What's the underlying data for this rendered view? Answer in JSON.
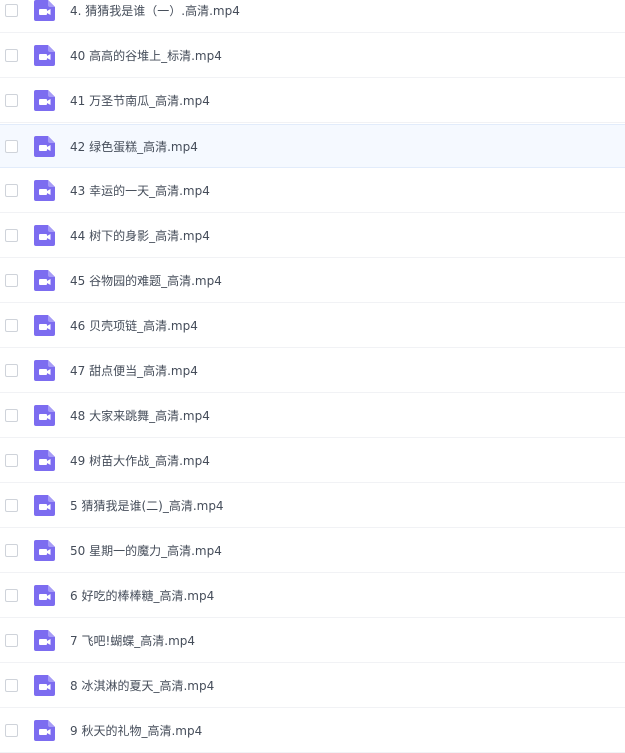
{
  "icons": {
    "row_icon": "video-file-icon",
    "checkbox": "checkbox"
  },
  "colors": {
    "icon_purple": "#7c6cf0",
    "highlight_bg": "#f5f9ff",
    "text": "#454d5a"
  },
  "files": [
    {
      "name": "4. 猜猜我是谁（一）.高清.mp4"
    },
    {
      "name": "40 高高的谷堆上_标清.mp4"
    },
    {
      "name": "41 万圣节南瓜_高清.mp4"
    },
    {
      "name": "42 绿色蛋糕_高清.mp4",
      "highlighted": true
    },
    {
      "name": "43 幸运的一天_高清.mp4"
    },
    {
      "name": "44 树下的身影_高清.mp4"
    },
    {
      "name": "45 谷物园的难题_高清.mp4"
    },
    {
      "name": "46 贝壳项链_高清.mp4"
    },
    {
      "name": "47 甜点便当_高清.mp4"
    },
    {
      "name": "48 大家来跳舞_高清.mp4"
    },
    {
      "name": "49 树苗大作战_高清.mp4"
    },
    {
      "name": "5 猜猜我是谁(二)_高清.mp4"
    },
    {
      "name": "50 星期一的魔力_高清.mp4"
    },
    {
      "name": "6 好吃的棒棒糖_高清.mp4"
    },
    {
      "name": "7 飞吧!蝴蝶_高清.mp4"
    },
    {
      "name": "8 冰淇淋的夏天_高清.mp4"
    },
    {
      "name": "9 秋天的礼物_高清.mp4"
    }
  ]
}
